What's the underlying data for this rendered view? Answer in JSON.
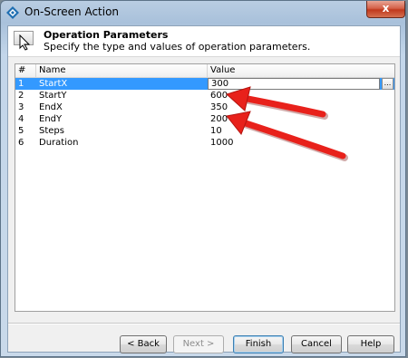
{
  "window": {
    "title": "On-Screen Action",
    "close_symbol": "x",
    "accent_color": "#3399ff",
    "icon": "diamond-app-icon"
  },
  "header": {
    "title": "Operation Parameters",
    "description": "Specify the type and values of operation parameters.",
    "icon": "cursor-icon"
  },
  "table": {
    "columns": [
      "#",
      "Name",
      "Value"
    ],
    "rows": [
      {
        "num": "1",
        "name": "StartX",
        "value": "300",
        "selected": true
      },
      {
        "num": "2",
        "name": "StartY",
        "value": "600"
      },
      {
        "num": "3",
        "name": "EndX",
        "value": "350"
      },
      {
        "num": "4",
        "name": "EndY",
        "value": "200"
      },
      {
        "num": "5",
        "name": "Steps",
        "value": "10"
      },
      {
        "num": "6",
        "name": "Duration",
        "value": "1000"
      }
    ],
    "edit_button_label": "..."
  },
  "buttons": {
    "back": "< Back",
    "next": "Next >",
    "finish": "Finish",
    "cancel": "Cancel",
    "help": "Help"
  },
  "annotation_color": "#e8211b"
}
